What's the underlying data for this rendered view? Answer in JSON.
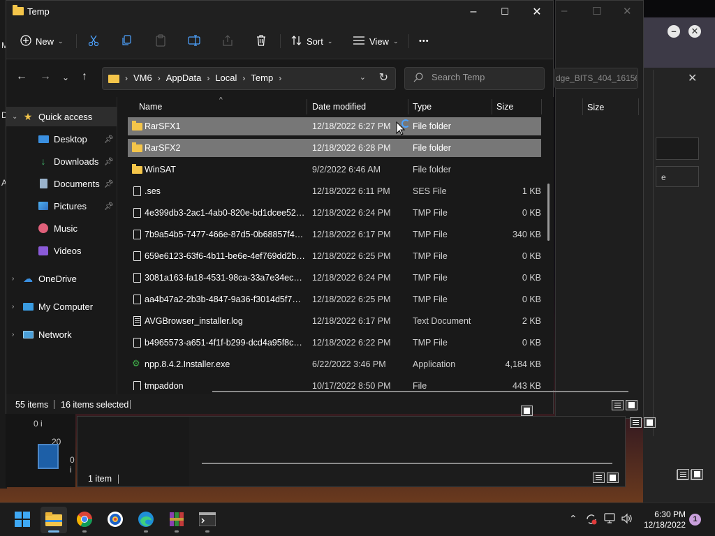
{
  "window": {
    "title": "Temp",
    "minimize_icon": "–",
    "maximize_icon": "☐",
    "close_icon": "✕"
  },
  "toolbar": {
    "new_label": "New",
    "sort_label": "Sort",
    "view_label": "View",
    "more_label": "•••"
  },
  "address": {
    "crumbs": [
      "VM6",
      "AppData",
      "Local",
      "Temp"
    ],
    "search_placeholder": "Search Temp"
  },
  "nav": {
    "quick_access": "Quick access",
    "items": [
      {
        "label": "Desktop",
        "icon": "desktop-icon",
        "pinned": true
      },
      {
        "label": "Downloads",
        "icon": "downloads-icon",
        "pinned": true
      },
      {
        "label": "Documents",
        "icon": "documents-icon",
        "pinned": true
      },
      {
        "label": "Pictures",
        "icon": "pictures-icon",
        "pinned": true
      },
      {
        "label": "Music",
        "icon": "music-icon",
        "pinned": false
      },
      {
        "label": "Videos",
        "icon": "videos-icon",
        "pinned": false
      }
    ],
    "onedrive": "OneDrive",
    "my_computer": "My Computer",
    "network": "Network"
  },
  "columns": {
    "name": "Name",
    "date": "Date modified",
    "type": "Type",
    "size": "Size"
  },
  "files": [
    {
      "name": "RarSFX1",
      "date": "12/18/2022 6:27 PM",
      "type": "File folder",
      "size": "",
      "icon": "folder",
      "selected": true
    },
    {
      "name": "RarSFX2",
      "date": "12/18/2022 6:28 PM",
      "type": "File folder",
      "size": "",
      "icon": "folder",
      "selected": true
    },
    {
      "name": "WinSAT",
      "date": "9/2/2022 6:46 AM",
      "type": "File folder",
      "size": "",
      "icon": "folder",
      "selected": false
    },
    {
      "name": ".ses",
      "date": "12/18/2022 6:11 PM",
      "type": "SES File",
      "size": "1 KB",
      "icon": "file",
      "selected": false
    },
    {
      "name": "4e399db3-2ac1-4ab0-820e-bd1dcee525e...",
      "date": "12/18/2022 6:24 PM",
      "type": "TMP File",
      "size": "0 KB",
      "icon": "file",
      "selected": false
    },
    {
      "name": "7b9a54b5-7477-466e-87d5-0b68857f4a88....",
      "date": "12/18/2022 6:17 PM",
      "type": "TMP File",
      "size": "340 KB",
      "icon": "file",
      "selected": false
    },
    {
      "name": "659e6123-63f6-4b11-be6e-4ef769dd2b5b....",
      "date": "12/18/2022 6:25 PM",
      "type": "TMP File",
      "size": "0 KB",
      "icon": "file",
      "selected": false
    },
    {
      "name": "3081a163-fa18-4531-98ca-33a7e34ecd7a....",
      "date": "12/18/2022 6:24 PM",
      "type": "TMP File",
      "size": "0 KB",
      "icon": "file",
      "selected": false
    },
    {
      "name": "aa4b47a2-2b3b-4847-9a36-f3014d5f70e0....",
      "date": "12/18/2022 6:25 PM",
      "type": "TMP File",
      "size": "0 KB",
      "icon": "file",
      "selected": false
    },
    {
      "name": "AVGBrowser_installer.log",
      "date": "12/18/2022 6:17 PM",
      "type": "Text Document",
      "size": "2 KB",
      "icon": "log",
      "selected": false
    },
    {
      "name": "b4965573-a651-4f1f-b299-dcd4a95f8cb9....",
      "date": "12/18/2022 6:22 PM",
      "type": "TMP File",
      "size": "0 KB",
      "icon": "file",
      "selected": false
    },
    {
      "name": "npp.8.4.2.Installer.exe",
      "date": "6/22/2022 3:46 PM",
      "type": "Application",
      "size": "4,184 KB",
      "icon": "app",
      "selected": false
    },
    {
      "name": "tmpaddon",
      "date": "10/17/2022 8:50 PM",
      "type": "File",
      "size": "443 KB",
      "icon": "file",
      "selected": false
    }
  ],
  "status": {
    "item_count": "55 items",
    "selected_count": "16 items selected"
  },
  "background": {
    "window_status": "1 item",
    "column_size": "Size",
    "address_fragment": "dge_BITS_404_16156...",
    "side_label_e": "e",
    "side_label_0i_a": "0 i",
    "side_label_0i_b": "0 i",
    "side_label_20": "20",
    "desk_m": "M",
    "desk_d": "D",
    "desk_a": "A"
  },
  "taskbar": {
    "apps": [
      {
        "name": "start-icon",
        "active": false
      },
      {
        "name": "file-explorer-icon",
        "active": true
      },
      {
        "name": "chrome-icon",
        "active": false
      },
      {
        "name": "avg-browser-icon",
        "active": false
      },
      {
        "name": "edge-icon",
        "active": false
      },
      {
        "name": "winrar-icon",
        "active": false
      },
      {
        "name": "terminal-icon",
        "active": false
      }
    ],
    "time": "6:30 PM",
    "date": "12/18/2022",
    "notification_count": "1"
  }
}
